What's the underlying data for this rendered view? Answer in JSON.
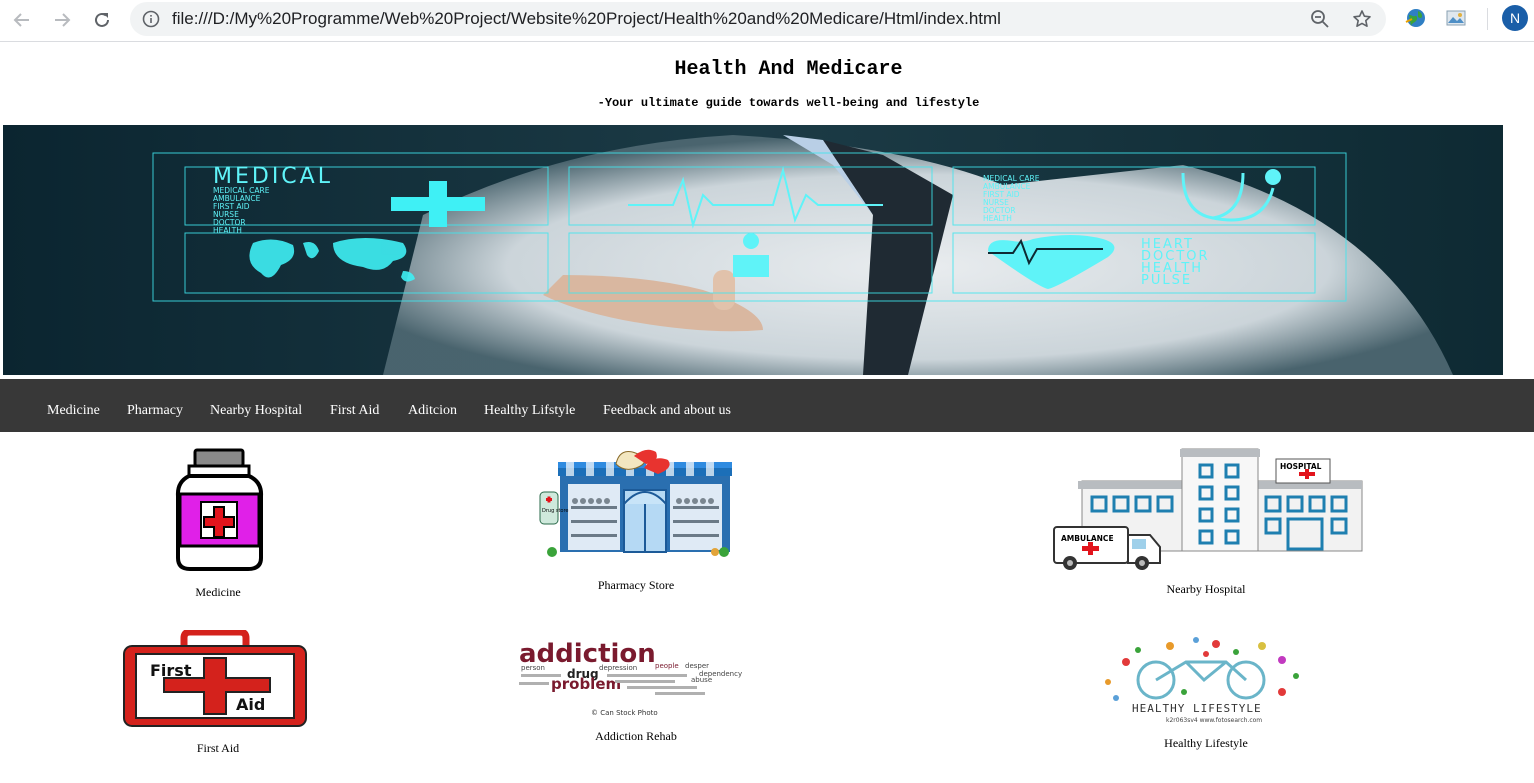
{
  "browser": {
    "url": "file:///D:/My%20Programme/Web%20Project/Website%20Project/Health%20and%20Medicare/Html/index.html",
    "profile_initial": "N",
    "icons": [
      "back-icon",
      "forward-icon",
      "reload-icon",
      "info-icon",
      "zoom-icon",
      "star-icon",
      "extension-icon",
      "extension-icon",
      "profile-avatar"
    ]
  },
  "header": {
    "title": "Health And Medicare",
    "subtitle": "-Your ultimate guide towards well-being and lifestyle"
  },
  "banner": {
    "headline": "MEDICAL",
    "left_list": [
      "MEDICAL CARE",
      "AMBULANCE",
      "FIRST AID",
      "NURSE",
      "DOCTOR",
      "HEALTH"
    ],
    "right_list": [
      "MEDICAL CARE",
      "AMBULANCE",
      "FIRST AID",
      "NURSE",
      "DOCTOR",
      "HEALTH"
    ],
    "bottom_list": [
      "HEART",
      "DOCTOR",
      "HEALTH",
      "PULSE"
    ]
  },
  "nav": {
    "items": [
      "Medicine",
      "Pharmacy",
      "Nearby Hospital",
      "First Aid",
      "Aditcion",
      "Healthy Lifstyle",
      "Feedback and about us"
    ]
  },
  "tiles": {
    "medicine": "Medicine",
    "pharmacy": "Pharmacy Store",
    "pharmacy_sign": "Drug store",
    "hospital": "Nearby Hospital",
    "hospital_sign": "HOSPITAL",
    "ambulance_sign": "AMBULANCE",
    "first_aid": "First Aid",
    "first_aid_word1": "First",
    "first_aid_word2": "Aid",
    "addiction": "Addiction Rehab",
    "addiction_word": "addiction",
    "addiction_drug": "drug",
    "addiction_problem": "problem",
    "addiction_words": [
      "person",
      "depression",
      "people",
      "desper",
      "abuse",
      "dependency"
    ],
    "addiction_credit": "© Can Stock Photo",
    "lifestyle": "Healthy Lifestyle",
    "lifestyle_word": "HEALTHY LIFESTYLE",
    "lifestyle_credit": "k2r063sv4 www.fotosearch.com"
  }
}
